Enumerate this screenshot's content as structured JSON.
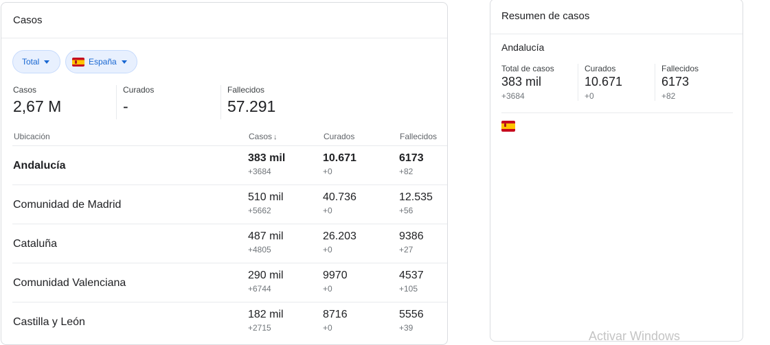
{
  "left": {
    "title": "Casos",
    "filters": {
      "total_label": "Total",
      "country_label": "España"
    },
    "stats": [
      {
        "label": "Casos",
        "value": "2,67 M"
      },
      {
        "label": "Curados",
        "value": "-"
      },
      {
        "label": "Fallecidos",
        "value": "57.291"
      }
    ],
    "columns": {
      "location": "Ubicación",
      "cases": "Casos",
      "recovered": "Curados",
      "deaths": "Fallecidos"
    },
    "rows": [
      {
        "name": "Andalucía",
        "cases": "383 mil",
        "cases_delta": "+3684",
        "recovered": "10.671",
        "recovered_delta": "+0",
        "deaths": "6173",
        "deaths_delta": "+82"
      },
      {
        "name": "Comunidad de Madrid",
        "cases": "510 mil",
        "cases_delta": "+5662",
        "recovered": "40.736",
        "recovered_delta": "+0",
        "deaths": "12.535",
        "deaths_delta": "+56"
      },
      {
        "name": "Cataluña",
        "cases": "487 mil",
        "cases_delta": "+4805",
        "recovered": "26.203",
        "recovered_delta": "+0",
        "deaths": "9386",
        "deaths_delta": "+27"
      },
      {
        "name": "Comunidad Valenciana",
        "cases": "290 mil",
        "cases_delta": "+6744",
        "recovered": "9970",
        "recovered_delta": "+0",
        "deaths": "4537",
        "deaths_delta": "+105"
      },
      {
        "name": "Castilla y León",
        "cases": "182 mil",
        "cases_delta": "+2715",
        "recovered": "8716",
        "recovered_delta": "+0",
        "deaths": "5556",
        "deaths_delta": "+39"
      }
    ]
  },
  "right": {
    "title": "Resumen de casos",
    "region": "Andalucía",
    "stats": [
      {
        "label": "Total de casos",
        "value": "383 mil",
        "delta": "+3684"
      },
      {
        "label": "Curados",
        "value": "10.671",
        "delta": "+0"
      },
      {
        "label": "Fallecidos",
        "value": "6173",
        "delta": "+82"
      }
    ]
  },
  "watermark": "Activar Windows",
  "colors": {
    "chip_bg": "#e8f0fe",
    "chip_text": "#1967d2",
    "flag_red": "#c60b1e",
    "flag_yellow": "#ffc400"
  },
  "icons": {
    "sort": "arrow-down-icon",
    "dropdown": "caret-down-icon",
    "flag": "spain-flag-icon"
  }
}
